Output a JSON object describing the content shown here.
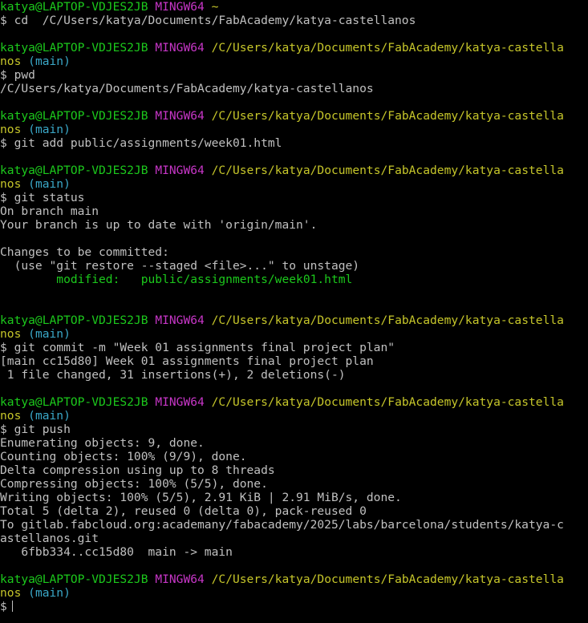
{
  "colors": {
    "background": "#000000",
    "text": "#c0c0c0",
    "user": "#1cc91c",
    "msystem": "#c736c7",
    "path": "#c6c62a",
    "branch": "#3aa8c8",
    "modified": "#1cc91c"
  },
  "prompt": {
    "user_host": "katya@LAPTOP-VDJES2JB",
    "msystem": "MINGW64",
    "home_path": "~",
    "path_part1": "/C/Users/katya/Documents/FabAcademy/katya-castella",
    "path_part2": "nos",
    "branch": "(main)",
    "symbol": "$"
  },
  "lines": {
    "cmd_cd": "$ cd  /C/Users/katya/Documents/FabAcademy/katya-castellanos",
    "cmd_pwd": "$ pwd",
    "out_pwd": "/C/Users/katya/Documents/FabAcademy/katya-castellanos",
    "cmd_add": "$ git add public/assignments/week01.html",
    "cmd_status": "$ git status",
    "status_1": "On branch main",
    "status_2": "Your branch is up to date with 'origin/main'.",
    "status_3": "Changes to be committed:",
    "status_4": "  (use \"git restore --staged <file>...\" to unstage)",
    "status_modified_label": "        modified:   ",
    "status_modified_file": "public/assignments/week01.html",
    "cmd_commit": "$ git commit -m \"Week 01 assignments final project plan\"",
    "commit_1": "[main cc15d80] Week 01 assignments final project plan",
    "commit_2": " 1 file changed, 31 insertions(+), 2 deletions(-)",
    "cmd_push": "$ git push",
    "push_1": "Enumerating objects: 9, done.",
    "push_2": "Counting objects: 100% (9/9), done.",
    "push_3": "Delta compression using up to 8 threads",
    "push_4": "Compressing objects: 100% (5/5), done.",
    "push_5": "Writing objects: 100% (5/5), 2.91 KiB | 2.91 MiB/s, done.",
    "push_6": "Total 5 (delta 2), reused 0 (delta 0), pack-reused 0",
    "push_7": "To gitlab.fabcloud.org:academany/fabacademy/2025/labs/barcelona/students/katya-c",
    "push_8": "astellanos.git",
    "push_9": "   6fbb334..cc15d80  main -> main",
    "final_symbol": "$"
  }
}
